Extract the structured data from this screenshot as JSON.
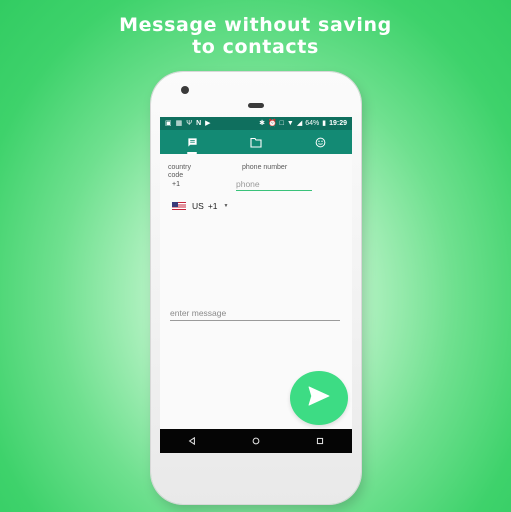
{
  "headline": {
    "line1": "Message without saving",
    "line2": "to contacts"
  },
  "statusbar": {
    "left_icons": [
      "image-icon",
      "app-icon",
      "usb-icon",
      "n-icon",
      "play-icon"
    ],
    "battery": "64%",
    "time": "19:29"
  },
  "tabs": [
    {
      "icon": "chat-icon",
      "active": true
    },
    {
      "icon": "folder-icon",
      "active": false
    },
    {
      "icon": "smiley-icon",
      "active": false
    }
  ],
  "form": {
    "country_code_label": "country code",
    "country_code_value": "+1",
    "phone_label": "phone number",
    "phone_placeholder": "phone",
    "country_select": {
      "flag": "us-flag-icon",
      "country": "US",
      "code": "+1"
    },
    "message_placeholder": "enter message"
  },
  "fab": {
    "icon": "send-icon"
  },
  "navbar": [
    "back-icon",
    "home-icon",
    "recents-icon"
  ],
  "colors": {
    "background": "#32cc62",
    "statusbar": "#0f6f5e",
    "toolbar": "#138a74",
    "accent": "#3ddc84"
  }
}
